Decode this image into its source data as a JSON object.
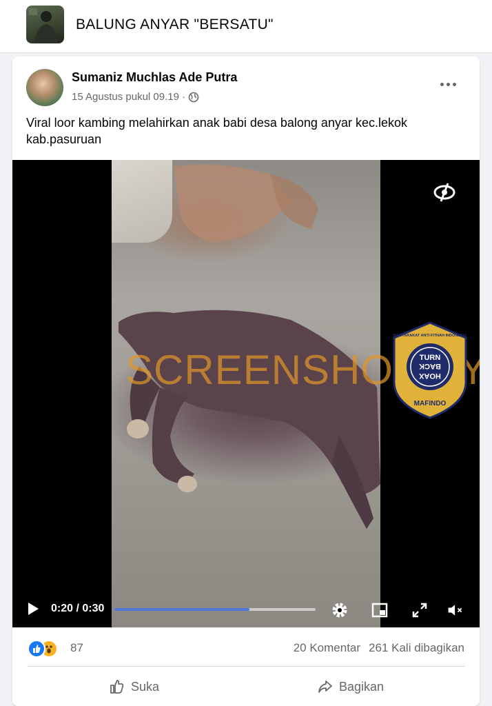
{
  "group": {
    "title": "BALUNG ANYAR \"BERSATU\""
  },
  "post": {
    "author": "Sumaniz Muchlas Ade Putra",
    "date": "15 Agustus pukul 09.19 ·",
    "text": "Viral loor kambing melahirkan anak babi desa balong anyar kec.lekok kab.pasuruan"
  },
  "video": {
    "watermark": "SCREENSHOT BY",
    "logo": {
      "top_text": "MASYARAKAT ANTI FITNAH INDONESIA",
      "line1": "TURN",
      "line2": "BACK",
      "line3": "HOAX",
      "bottom_text": "MAFINDO"
    },
    "time": "0:20 / 0:30",
    "progress": 0.67
  },
  "stats": {
    "reactions": "87",
    "comments": "20 Komentar",
    "shares": "261 Kali dibagikan"
  },
  "actions": {
    "like": "Suka",
    "share": "Bagikan"
  },
  "colors": {
    "accent": "#1877f2",
    "progress": "#4e79d6",
    "watermark": "#de9628"
  }
}
